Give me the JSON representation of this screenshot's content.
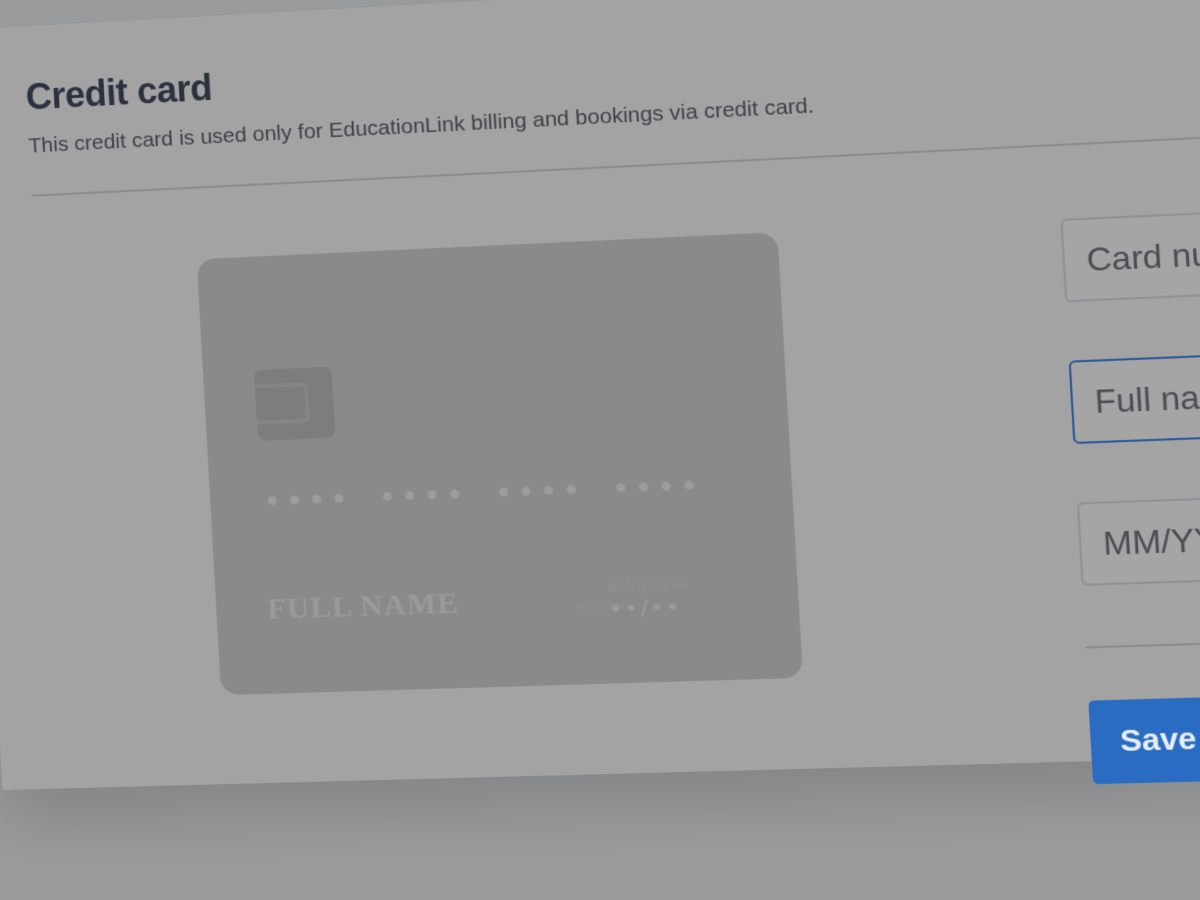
{
  "section": {
    "title": "Credit card",
    "subtitle": "This credit card is used only for EducationLink billing and bookings via credit card."
  },
  "card_preview": {
    "number": "•••• •••• •••• ••••",
    "name": "FULL NAME",
    "valid_label": "MONTH/YEAR",
    "valid_small": "VALID\nTHRU",
    "expiry": "••/••"
  },
  "form": {
    "card_number_placeholder": "Card number",
    "full_name_placeholder": "Full name",
    "expiry_placeholder": "MM/YY",
    "save_label": "Save"
  },
  "colors": {
    "primary_button": "#2a6cc2",
    "focused_border": "#2a5a9e"
  }
}
